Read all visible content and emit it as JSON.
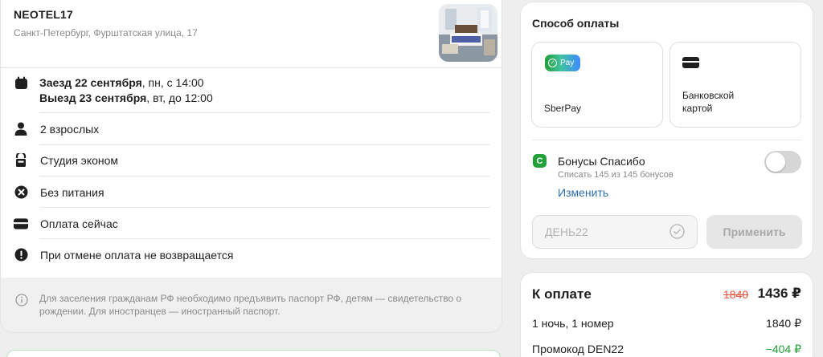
{
  "hotel": {
    "name": "NEOTEL17",
    "address": "Санкт-Петербург, Фурштатская улица, 17"
  },
  "booking": {
    "checkin_bold": "Заезд 22 сентября",
    "checkin_rest": ", пн, с 14:00",
    "checkout_bold": "Выезд 23 сентября",
    "checkout_rest": ", вт, до 12:00",
    "guests": "2 взрослых",
    "room": "Студия эконом",
    "meals": "Без питания",
    "payment": "Оплата сейчас",
    "cancellation": "При отмене оплата не возвращается"
  },
  "notice": "Для заселения гражданам РФ необходимо предъявить паспорт РФ, детям — свидетельство о рождении. Для иностранцев — иностранный паспорт.",
  "payment_method": {
    "title": "Способ оплаты",
    "options": [
      {
        "label": "SberPay",
        "badge": "Pay"
      },
      {
        "label_line1": "Банковской",
        "label_line2": "картой"
      }
    ]
  },
  "bonus": {
    "title": "Бонусы Спасибо",
    "subtitle": "Списать 145 из 145 бонусов",
    "link": "Изменить",
    "icon_letter": "С",
    "enabled": false
  },
  "promo": {
    "value": "ДЕНЬ22",
    "apply_label": "Применить"
  },
  "total": {
    "title": "К оплате",
    "old_price": "1840",
    "new_price": "1436 ₽",
    "rows": [
      {
        "label": "1 ночь, 1 номер",
        "value": "1840 ₽"
      },
      {
        "label": "Промокод DEN22",
        "value": "−404 ₽"
      }
    ]
  },
  "colors": {
    "accent_green": "#21a038",
    "link_blue": "#2f6fb3",
    "strike_red": "#e5533c"
  }
}
